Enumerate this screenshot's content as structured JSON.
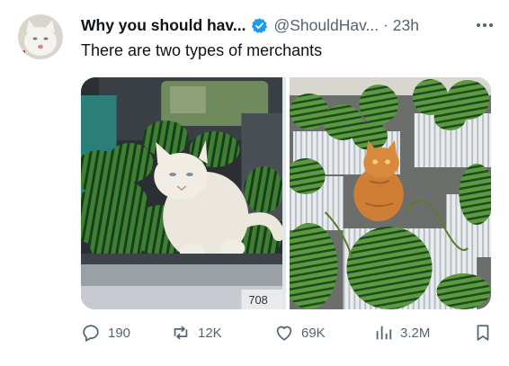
{
  "author": {
    "display_name": "Why you should hav...",
    "handle": "@ShouldHav...",
    "time": "23h",
    "avatar_icon": "white-cat-avatar",
    "verified_color": "#1d9bf0"
  },
  "tweet": {
    "text": "There are two types of merchants",
    "media": [
      {
        "icon": "photo-cat-in-car-trunk-with-watermelons"
      },
      {
        "icon": "photo-orange-cat-among-watermelon-baskets"
      }
    ]
  },
  "actions": {
    "replies": "190",
    "reposts": "12K",
    "likes": "69K",
    "views": "3.2M"
  },
  "colors": {
    "text": "#0f1419",
    "secondary": "#536471",
    "accent": "#1d9bf0"
  }
}
